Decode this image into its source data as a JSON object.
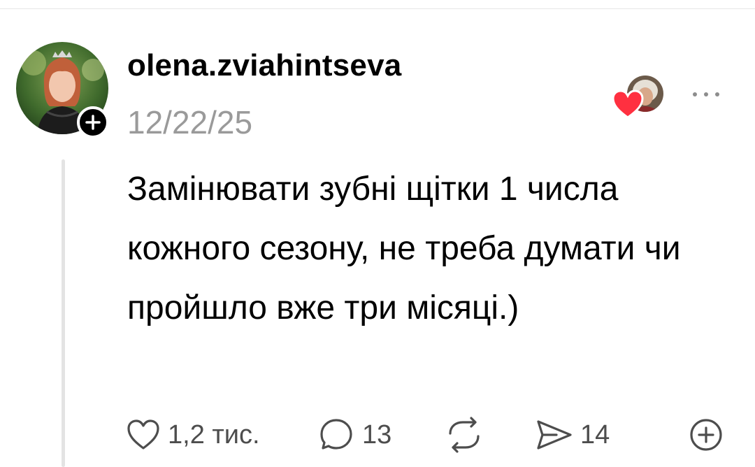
{
  "post": {
    "username": "olena.zviahintseva",
    "date": "12/22/25",
    "text": "Замінювати зубні щітки 1 числа кожного сезону, не треба думати чи пройшло вже три місяці.)"
  },
  "actions": {
    "likes": "1,2 тис.",
    "comments": "13",
    "shares": "14"
  },
  "colors": {
    "heart": "#ff3040",
    "muted_text": "#9a9a9a",
    "icon": "#4d4d4d"
  },
  "icons": [
    "plus-icon",
    "heart-icon",
    "comment-icon",
    "repost-icon",
    "send-icon",
    "add-icon",
    "more-icon"
  ]
}
